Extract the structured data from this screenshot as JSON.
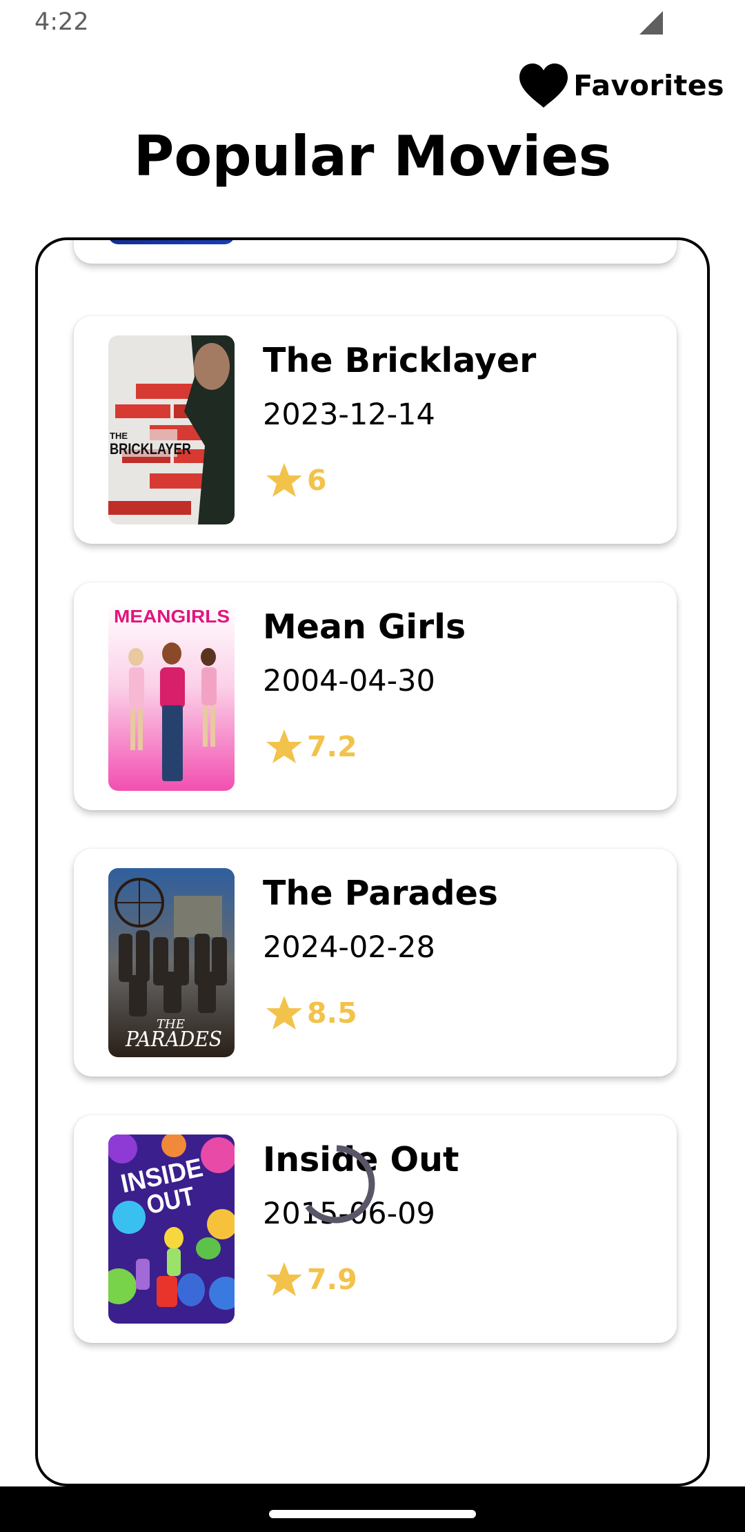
{
  "status_bar": {
    "time": "4:22"
  },
  "header": {
    "favorites_label": "Favorites",
    "title": "Popular Movies"
  },
  "movies": [
    {
      "title": "The Bricklayer",
      "date": "2023-12-14",
      "rating": "6",
      "poster_icon": "bricklayer-poster"
    },
    {
      "title": "Mean Girls",
      "date": "2004-04-30",
      "rating": "7.2",
      "poster_icon": "mean-girls-poster"
    },
    {
      "title": "The Parades",
      "date": "2024-02-28",
      "rating": "8.5",
      "poster_icon": "the-parades-poster"
    },
    {
      "title": "Inside Out",
      "date": "2015-06-09",
      "rating": "7.9",
      "poster_icon": "inside-out-poster"
    }
  ],
  "colors": {
    "rating_accent": "#f2c24a",
    "spinner": "#5b5568",
    "frame_border": "#000000"
  }
}
